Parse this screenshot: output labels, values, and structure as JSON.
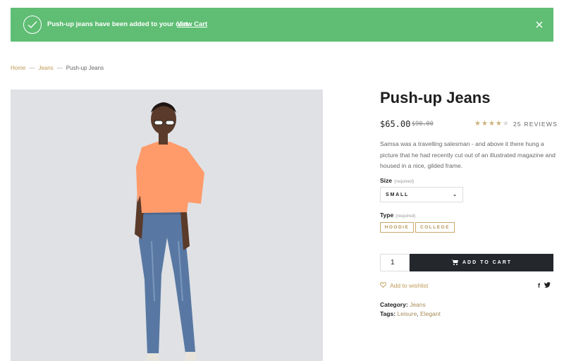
{
  "notice": {
    "message": "Push-up jeans have been added to your cart.",
    "link": "View Cart"
  },
  "breadcrumb": [
    "Home",
    "Jeans",
    "Push-up Jeans"
  ],
  "breadcrumb_sep": "—",
  "product": {
    "title": "Push-up Jeans",
    "price": "$65.00",
    "old_price": "$90.00",
    "rating": 4,
    "rating_max": 5,
    "reviews": "25 REVIEWS",
    "description": "Samsa was a travelling salesman - and above it there hung a picture that he had recently cut out of an illustrated magazine and housed in a nice, gilded frame.",
    "size": {
      "label": "Size",
      "required": "(required)",
      "selected": "SMALL"
    },
    "type": {
      "label": "Type",
      "required": "(required)",
      "options": [
        "HOODIE",
        "COLLEGE"
      ]
    },
    "quantity": "1",
    "add_to_cart": "ADD TO CART",
    "wishlist": "Add to wishlist",
    "social": [
      "f",
      "t"
    ],
    "category_label": "Category:",
    "category": "Jeans",
    "tags_label": "Tags:",
    "tags": [
      "Leisure",
      "Elegant"
    ]
  },
  "colors": {
    "notice_bg": "#5fbd74",
    "accent": "#c09a56",
    "button_bg": "#24272c",
    "star": "#c8b277"
  }
}
